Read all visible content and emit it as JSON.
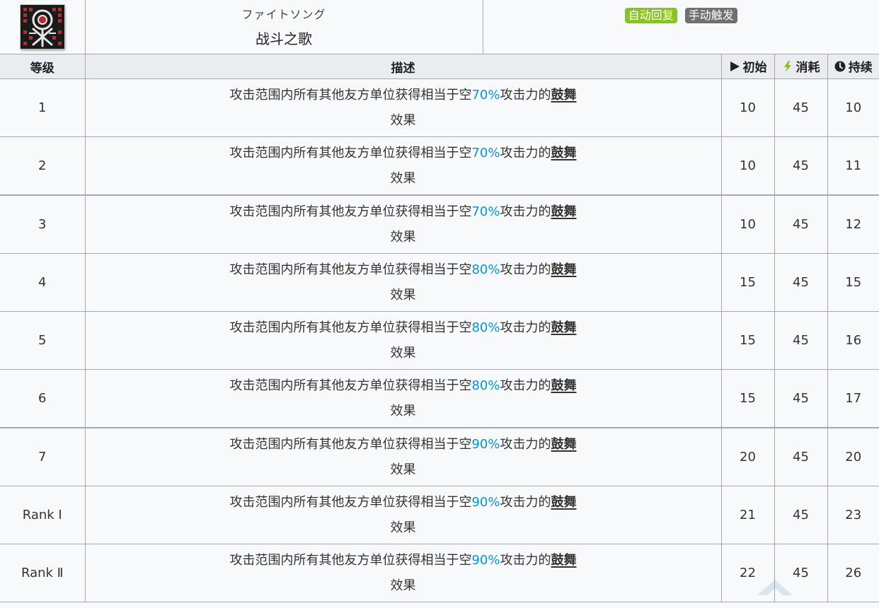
{
  "skill": {
    "icon": "crossed-swords-skill-icon",
    "name_jp": "ファイトソング",
    "name_cn": "战斗之歌",
    "tags": [
      {
        "label": "自动回复",
        "color": "#8ac125"
      },
      {
        "label": "手动触发",
        "color": "#707070"
      }
    ]
  },
  "table": {
    "headers": {
      "level": "等级",
      "description": "描述",
      "initial": "初始",
      "cost": "消耗",
      "duration": "持续"
    },
    "header_icons": {
      "initial": "play-icon",
      "cost": "lightning-icon",
      "duration": "clock-icon"
    },
    "desc_parts": {
      "prefix": "攻击范围内所有其他友方单位获得相当于空",
      "mid": "攻击力的",
      "keyword": "鼓舞",
      "suffix": "效果"
    },
    "rows": [
      {
        "level": "1",
        "pct": "70%",
        "initial": "10",
        "cost": "45",
        "duration": "10"
      },
      {
        "level": "2",
        "pct": "70%",
        "initial": "10",
        "cost": "45",
        "duration": "11"
      },
      {
        "level": "3",
        "pct": "70%",
        "initial": "10",
        "cost": "45",
        "duration": "12"
      },
      {
        "level": "4",
        "pct": "80%",
        "initial": "15",
        "cost": "45",
        "duration": "15"
      },
      {
        "level": "5",
        "pct": "80%",
        "initial": "15",
        "cost": "45",
        "duration": "16"
      },
      {
        "level": "6",
        "pct": "80%",
        "initial": "15",
        "cost": "45",
        "duration": "17"
      },
      {
        "level": "7",
        "pct": "90%",
        "initial": "20",
        "cost": "45",
        "duration": "20"
      },
      {
        "level": "Rank Ⅰ",
        "pct": "90%",
        "initial": "21",
        "cost": "45",
        "duration": "23"
      },
      {
        "level": "Rank Ⅱ",
        "pct": "90%",
        "initial": "22",
        "cost": "45",
        "duration": "26"
      }
    ]
  },
  "colors": {
    "percent": "#0098dc",
    "header_bg": "#eaecf0",
    "border": "#a2a9b1",
    "cost_icon": "#8ac125"
  }
}
